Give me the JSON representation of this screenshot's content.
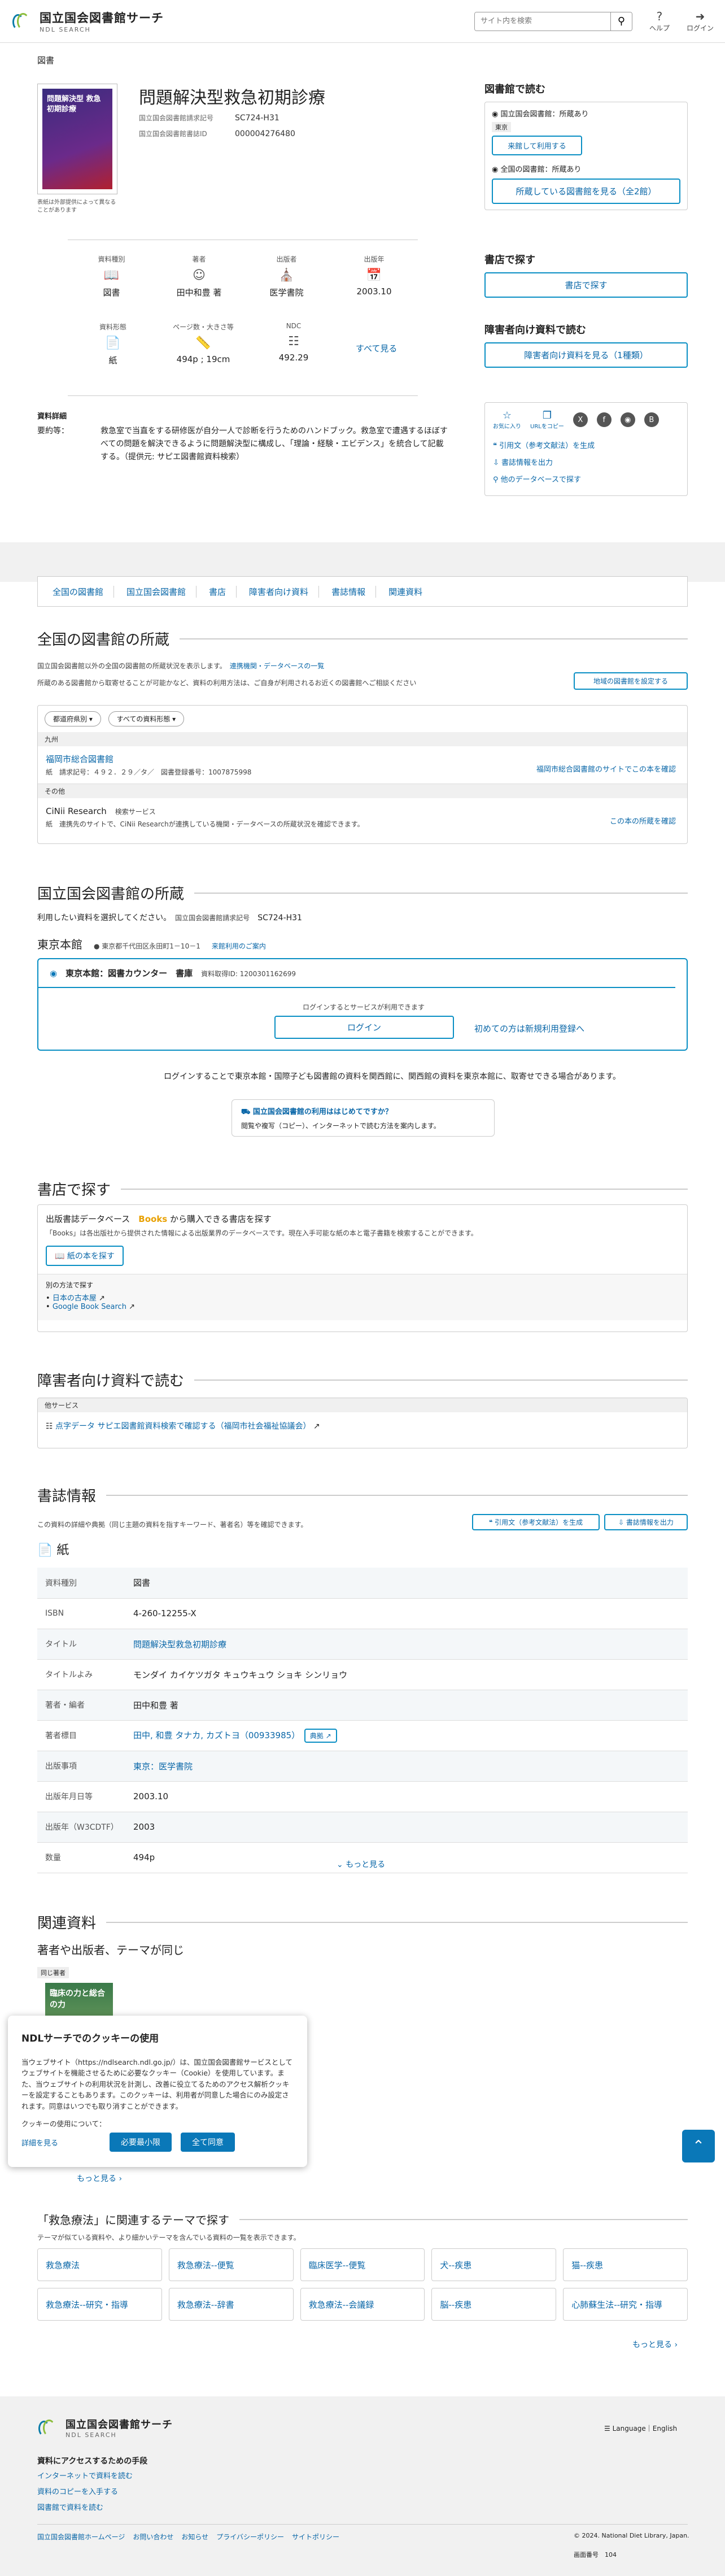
{
  "header": {
    "site_name": "国立国会図書館サーチ",
    "site_sub": "NDL SEARCH",
    "search_placeholder": "サイト内を検索",
    "help_label": "ヘルプ",
    "login_label": "ログイン"
  },
  "crumb": "図書",
  "book": {
    "cover_title": "問題解決型 救急初期診療",
    "cover_note": "表紙は外部提供によって異なることがあります",
    "title": "問題解決型救急初期診療",
    "call_no_label": "国立国会図書館請求記号",
    "call_no": "SC724-H31",
    "biblio_id_label": "国立国会図書館書誌ID",
    "biblio_id": "000004276480"
  },
  "info_boxes": [
    {
      "label": "資料種別",
      "icon": "book-icon",
      "value": "図書"
    },
    {
      "label": "著者",
      "icon": "person-icon",
      "value": "田中和豊 著"
    },
    {
      "label": "出版者",
      "icon": "building-icon",
      "value": "医学書院"
    },
    {
      "label": "出版年",
      "icon": "calendar-icon",
      "value": "2003.10"
    },
    {
      "label": "資料形態",
      "icon": "paper-icon",
      "value": "紙"
    },
    {
      "label": "ページ数・大きさ等",
      "icon": "ruler-icon",
      "value": "494p ; 19cm"
    },
    {
      "label": "NDC",
      "icon": "tag-icon",
      "value": "492.29"
    }
  ],
  "see_all": "すべて見る",
  "detail": {
    "section_label": "資料詳細",
    "key": "要約等：",
    "text": "救急室で当直をする研修医が自分一人で診断を行うためのハンドブック。救急室で遭遇するほぼすべての問題を解決できるように問題解決型に構成し、「理論・経験・エビデンス」を統合して記載する。（提供元: サピエ図書館資料検索）"
  },
  "right_col": {
    "read_title": "図書館で読む",
    "ndl_status": "国立国会図書館：所蔵あり",
    "tokyo": "東京",
    "ndl_btn": "来館して利用する",
    "all_status": "全国の図書館：所蔵あり",
    "all_btn": "所蔵している図書館を見る（全2館）",
    "shop_title": "書店で探す",
    "shop_btn": "書店で探す",
    "acc_title": "障害者向け資料で読む",
    "acc_btn": "障害者向け資料を見る（1種類）",
    "share_fav": "お気に入り",
    "share_url": "URLをコピー",
    "link_cite": "引用文（参考文献法）を生成",
    "link_export": "書誌情報を出力",
    "link_other": "他のデータベースで探す"
  },
  "tabs": [
    "全国の図書館",
    "国立国会図書館",
    "書店",
    "障害者向け資料",
    "書誌情報",
    "関連資料"
  ],
  "all_libs": {
    "heading": "全国の図書館の所蔵",
    "desc1": "国立国会図書館以外の全国の図書館の所蔵状況を表示します。",
    "desc_link": "連携機関・データベースの一覧",
    "desc2": "所蔵のある図書館から取寄せることが可能かなど、資料の利用方法は、ご自身が利用されるお近くの図書館へご相談ください",
    "region_btn": "地域の図書館を設定する",
    "filter1": "都道府県別",
    "filter2": "すべての資料形態",
    "group1": "九州",
    "lib1_name": "福岡市総合図書館",
    "lib1_detail": "紙　請求記号：４９２．２９／タ／　図書登録番号：1007875998",
    "lib1_link": "福岡市総合図書館のサイトでこの本を確認",
    "group2": "その他",
    "lib2_name": "CiNii Research",
    "lib2_tag": "検索サービス",
    "lib2_detail": "紙　連携先のサイトで、CiNii Researchが連携している機関・データベースの所蔵状況を確認できます。",
    "lib2_link": "この本の所蔵を確認"
  },
  "ndl": {
    "heading": "国立国会図書館の所蔵",
    "desc": "利用したい資料を選択してください。",
    "call_label": "国立国会図書館請求記号",
    "call_no": "SC724-H31",
    "branch": "東京本館",
    "address": "東京都千代田区永田町1－10－1",
    "visit_link": "来館利用のご案内",
    "item": "東京本館：図書カウンター　書庫",
    "item_id": "資料取得ID: 1200301162699",
    "login_prompt": "ログインするとサービスが利用できます",
    "login_btn": "ログイン",
    "register": "初めての方は新規利用登録へ",
    "note": "ログインすることで東京本館・国際子ども図書館の資料を関西館に、関西館の資料を東京本館に、取寄せできる場合があります。",
    "guide_title": "国立国会図書館の利用ははじめてですか？",
    "guide_text": "閲覧や複写（コピー）、インターネットで読む方法を案内します。"
  },
  "shop": {
    "heading": "書店で探す",
    "title_pre": "出版書誌データベース",
    "title_brand": "Books",
    "title_post": "から購入できる書店を探す",
    "desc": "「Books」は各出版社から提供された情報による出版業界のデータベースです。現在入手可能な紙の本と電子書籍を検索することができます。",
    "btn": "紙の本を探す",
    "other": "別の方法で探す",
    "link1": "日本の古本屋",
    "link2": "Google Book Search"
  },
  "acc": {
    "heading": "障害者向け資料で読む",
    "group": "他サービス",
    "link": "点字データ サピエ図書館資料検索で確認する（福岡市社会福祉協議会）"
  },
  "bib": {
    "heading": "書誌情報",
    "desc": "この資料の詳細や典拠（同じ主題の資料を指すキーワード、著者名）等を確認できます。",
    "cite_btn": "引用文（参考文献法）を生成",
    "export_btn": "書誌情報を出力",
    "type": "紙",
    "rows": [
      {
        "k": "資料種別",
        "v": "図書"
      },
      {
        "k": "ISBN",
        "v": "4-260-12255-X"
      },
      {
        "k": "タイトル",
        "v": "問題解決型救急初期診療"
      },
      {
        "k": "タイトルよみ",
        "v": "モンダイ カイケツガタ キュウキュウ ショキ シンリョウ"
      },
      {
        "k": "著者・編者",
        "v": "田中和豊 著"
      },
      {
        "k": "著者標目",
        "v": "田中, 和豊 タナカ, カズトヨ（00933985）"
      },
      {
        "k": "出版事項",
        "v": "東京：医学書院"
      },
      {
        "k": "出版年月日等",
        "v": "2003.10"
      },
      {
        "k": "出版年（W3CDTF）",
        "v": "2003"
      },
      {
        "k": "数量",
        "v": "494p"
      }
    ],
    "authority": "典拠",
    "more": "もっと見る"
  },
  "related": {
    "heading": "関連資料",
    "sub": "著者や出版者、テーマが同じ",
    "badge": "同じ著者",
    "cover_title": "臨床の力と総合の力",
    "more": "もっと見る"
  },
  "theme": {
    "heading": "「救急療法」に関連するテーマで探す",
    "desc": "テーマが似ている資料や、より細かいテーマを含んでいる資料の一覧を表示できます。",
    "tags": [
      "救急療法",
      "救急療法--便覧",
      "臨床医学--便覧",
      "犬--疾患",
      "猫--疾患",
      "救急療法--研究・指導",
      "救急療法--辞書",
      "救急療法--会議録",
      "脳--疾患",
      "心肺蘇生法--研究・指導"
    ],
    "more": "もっと見る"
  },
  "cookie": {
    "title": "NDLサーチでのクッキーの使用",
    "text": "当ウェブサイト（https://ndlsearch.ndl.go.jp/）は、国立国会図書館サービスとしてウェブサイトを機能させるために必要なクッキー（Cookie）を使用しています。また、当ウェブサイトの利用状況を計測し、改善に役立てるためのアクセス解析クッキーを設定することもあります。このクッキーは、利用者が同意した場合にのみ設定されます。同意はいつでも取り消すことができます。",
    "usage": "クッキーの使用について：",
    "detail": "詳細を見る",
    "necessary": "必要最小限",
    "accept": "全て同意"
  },
  "footer": {
    "site_name": "国立国会図書館サーチ",
    "site_sub": "NDL SEARCH",
    "lang": "Language｜English",
    "access_title": "資料にアクセスするための手段",
    "links": [
      "インターネットで資料を読む",
      "資料のコピーを入手する",
      "図書館で資料を読む"
    ],
    "bottom_links": [
      "国立国会図書館ホームページ",
      "お問い合わせ",
      "お知らせ",
      "プライバシーポリシー",
      "サイトポリシー"
    ],
    "copyright": "© 2024. National Diet Library, Japan.",
    "ver_label": "画面番号",
    "ver": "104"
  }
}
